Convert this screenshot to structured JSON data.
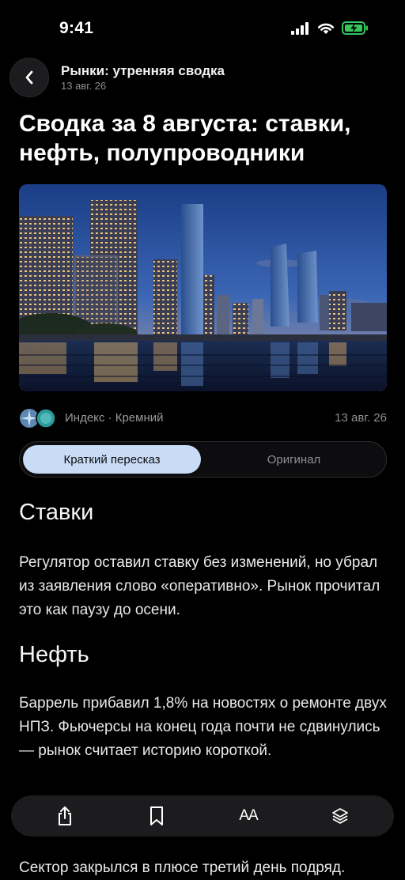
{
  "status_bar": {
    "time": "9:41",
    "battery_color": "#34c759"
  },
  "header": {
    "title": "Рынки: утренняя сводка",
    "date": "13 авг. 26"
  },
  "article": {
    "headline": "Сводка за 8 августа: ставки, нефть, полупроводники",
    "hero_image": "city skyline at dusk reflected in water",
    "source_name": "Индекс · Кремний",
    "source_date": "13 авг. 26",
    "tabs": {
      "active": "Краткий пересказ",
      "inactive": "Оригинал"
    },
    "sections": [
      {
        "title": "Ставки",
        "text": "Регулятор оставил ставку без изменений, но убрал из заявления слово «оперативно». Рынок прочитал это как паузу до осени."
      },
      {
        "title": "Нефть",
        "text": "Баррель прибавил 1,8% на новостях о ремонте двух НПЗ. Фьючерсы на конец года почти не сдвинулись — рынок считает историю короткой."
      }
    ],
    "trailing_text": "Сектор закрылся в плюсе третий день подряд."
  },
  "toolbar": {
    "share_icon": "share-icon",
    "bookmark_icon": "bookmark-icon",
    "text_size_label": "AA",
    "layers_icon": "layers-icon"
  }
}
